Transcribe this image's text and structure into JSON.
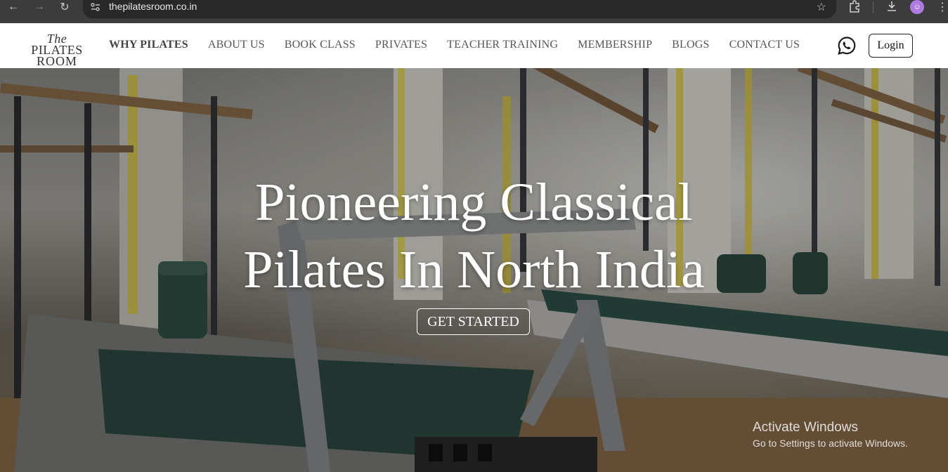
{
  "browser": {
    "url": "thepilatesroom.co.in"
  },
  "header": {
    "logo_line1_italic": "The",
    "logo_line1": "PILATES",
    "logo_line2": "ROOM",
    "nav": [
      {
        "label": "WHY PILATES"
      },
      {
        "label": "ABOUT US"
      },
      {
        "label": "BOOK CLASS"
      },
      {
        "label": "PRIVATES"
      },
      {
        "label": "TEACHER TRAINING"
      },
      {
        "label": "MEMBERSHIP"
      },
      {
        "label": "BLOGS"
      },
      {
        "label": "CONTACT US"
      }
    ],
    "login_label": "Login"
  },
  "hero": {
    "title_line1": "Pioneering Classical",
    "title_line2": "Pilates In North India",
    "cta_label": "GET STARTED"
  },
  "watermark": {
    "line1": "Activate Windows",
    "line2": "Go to Settings to activate Windows."
  },
  "colors": {
    "whatsapp_icon": "#1a1a1a",
    "chrome_bg": "#3c3c3c",
    "profile_avatar": "#b07be0"
  }
}
